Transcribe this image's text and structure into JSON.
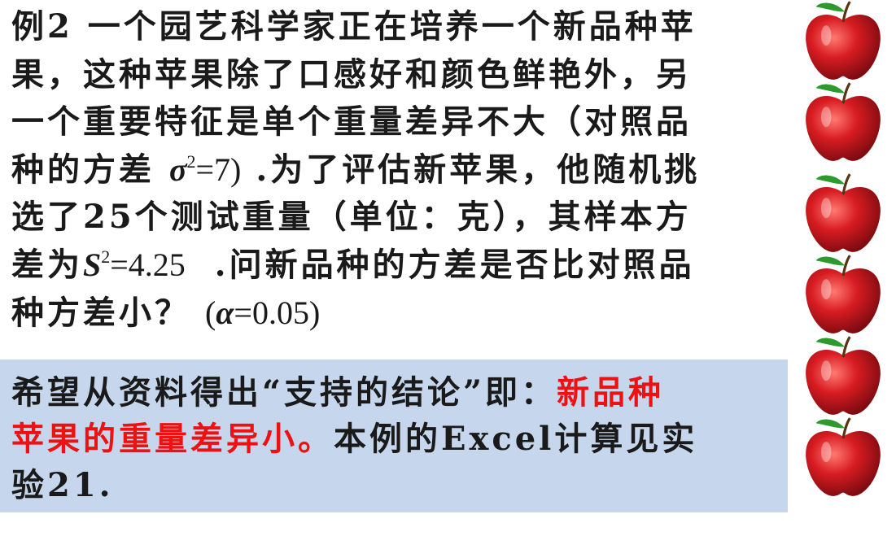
{
  "problem": {
    "line1": "例2 一个园艺科学家正在培养一个新品种苹",
    "line2": "果，这种苹果除了口感好和颜色鲜艳外，另",
    "line3": "一个重要特征是单个重量差异不大（对照品",
    "line4_pre": "种的方差",
    "sigma_symbol": "σ",
    "sigma_exponent": "2",
    "sigma_value": "=7)",
    "line4_post": ".为了评估新苹果，他随机挑",
    "line5": "选了25个测试重量（单位：克），其样本方",
    "line6_pre": "差为",
    "s_symbol": "S",
    "s_exponent": "2",
    "s_value": "=4.25",
    "line6_post": ".问新品种的方差是否比对照品",
    "line7_pre": "种方差小？",
    "alpha_open": "(",
    "alpha_symbol": "α",
    "alpha_value": "=0.05)"
  },
  "callout": {
    "part1": "希望从资料得出“支持的结论”即：",
    "highlight_a": "新品种",
    "highlight_b": "苹果的重量差异小。",
    "part2": "本例的Excel计算见实",
    "part3": "验21."
  },
  "colors": {
    "callout_bg": "#c6d6ec",
    "highlight": "#ee1111",
    "apple_red": "#d81c22",
    "leaf_green": "#2e9a2e"
  },
  "decoration": {
    "icon": "apple-icon",
    "count": 6
  }
}
